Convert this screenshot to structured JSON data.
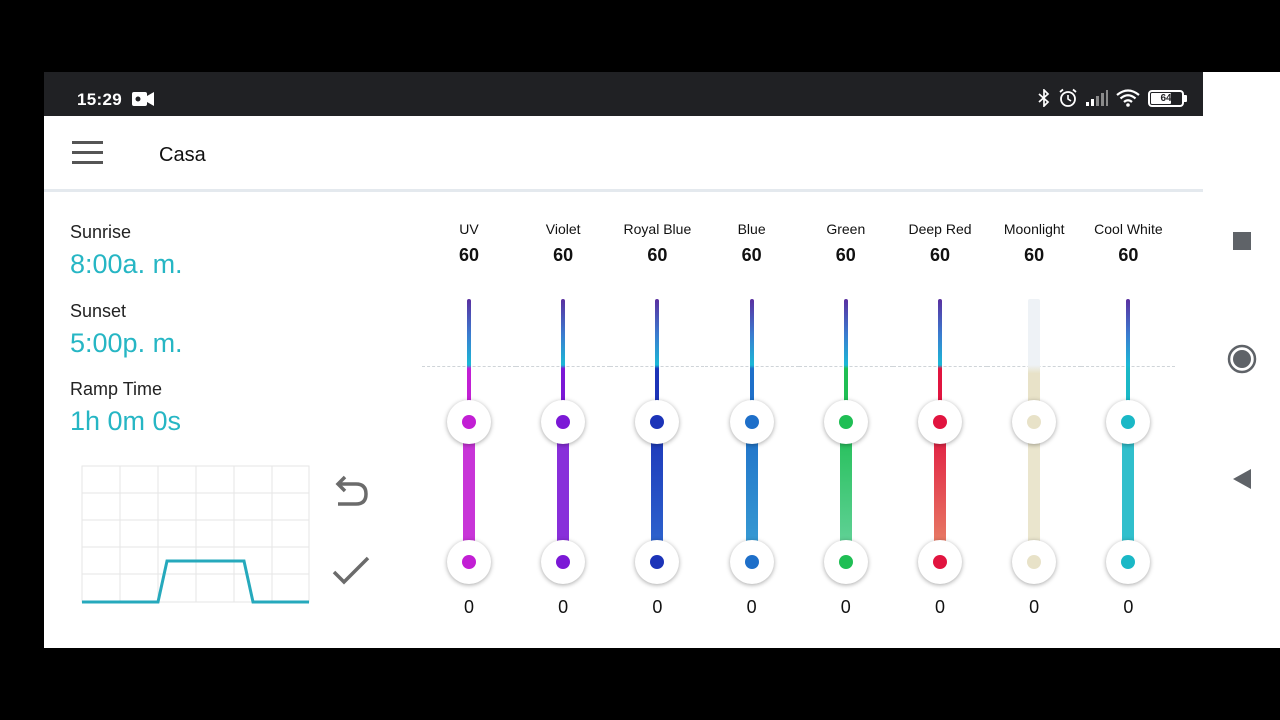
{
  "status": {
    "time": "15:29",
    "battery": "64",
    "icons": [
      "video-recording-icon",
      "bluetooth-icon",
      "alarm-icon",
      "signal-icon",
      "wifi-icon",
      "battery-icon"
    ]
  },
  "appbar": {
    "title": "Casa",
    "menu_icon": "hamburger-menu-icon"
  },
  "schedule": {
    "sunrise_label": "Sunrise",
    "sunrise_value": "8:00a. m.",
    "sunset_label": "Sunset",
    "sunset_value": "5:00p. m.",
    "ramp_label": "Ramp Time",
    "ramp_value": "1h 0m 0s"
  },
  "actions": {
    "undo_icon": "undo-icon",
    "confirm_icon": "check-icon"
  },
  "channels": [
    {
      "name": "UV",
      "max": "60",
      "min": "0",
      "color": "#c21fd4"
    },
    {
      "name": "Violet",
      "max": "60",
      "min": "0",
      "color": "#7b18d6"
    },
    {
      "name": "Royal Blue",
      "max": "60",
      "min": "0",
      "color": "#1c34b8"
    },
    {
      "name": "Blue",
      "max": "60",
      "min": "0",
      "color": "#1e6fc9"
    },
    {
      "name": "Green",
      "max": "60",
      "min": "0",
      "color": "#1fbe54"
    },
    {
      "name": "Deep Red",
      "max": "60",
      "min": "0",
      "color": "#e1143f"
    },
    {
      "name": "Moonlight",
      "max": "60",
      "min": "0",
      "color": "#e8e2c8"
    },
    {
      "name": "Cool White",
      "max": "60",
      "min": "0",
      "color": "#1ab8c6"
    }
  ],
  "colors": {
    "accent": "#26b6c4",
    "statusbar": "#202124"
  },
  "nav": [
    "recents-square-icon",
    "home-circle-icon",
    "back-triangle-icon"
  ]
}
